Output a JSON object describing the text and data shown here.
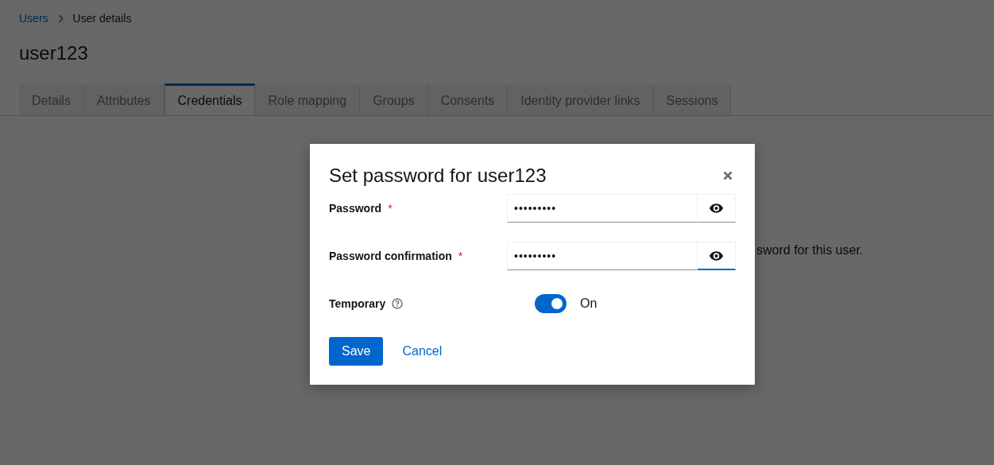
{
  "breadcrumb": [
    {
      "label": "Users",
      "kind": "link"
    },
    {
      "label": "User details",
      "kind": "current"
    }
  ],
  "page_title": "user123",
  "tabs": [
    {
      "label": "Details",
      "selected": false
    },
    {
      "label": "Attributes",
      "selected": false
    },
    {
      "label": "Credentials",
      "selected": true
    },
    {
      "label": "Role mapping",
      "selected": false
    },
    {
      "label": "Groups",
      "selected": false
    },
    {
      "label": "Consents",
      "selected": false
    },
    {
      "label": "Identity provider links",
      "selected": false
    },
    {
      "label": "Sessions",
      "selected": false
    }
  ],
  "background_text": "sword for this user.",
  "dialog": {
    "title": "Set password for user123",
    "fields": [
      {
        "label": "Password",
        "required_mark": "*",
        "value": "•••••••••",
        "reveal_focused": false
      },
      {
        "label": "Password confirmation",
        "required_mark": "*",
        "value": "•••••••••",
        "reveal_focused": true
      }
    ],
    "temporary": {
      "label": "Temporary",
      "on": true,
      "state_label": "On"
    },
    "buttons": [
      {
        "label": "Save",
        "kind": "primary"
      },
      {
        "label": "Cancel",
        "kind": "link"
      }
    ]
  }
}
